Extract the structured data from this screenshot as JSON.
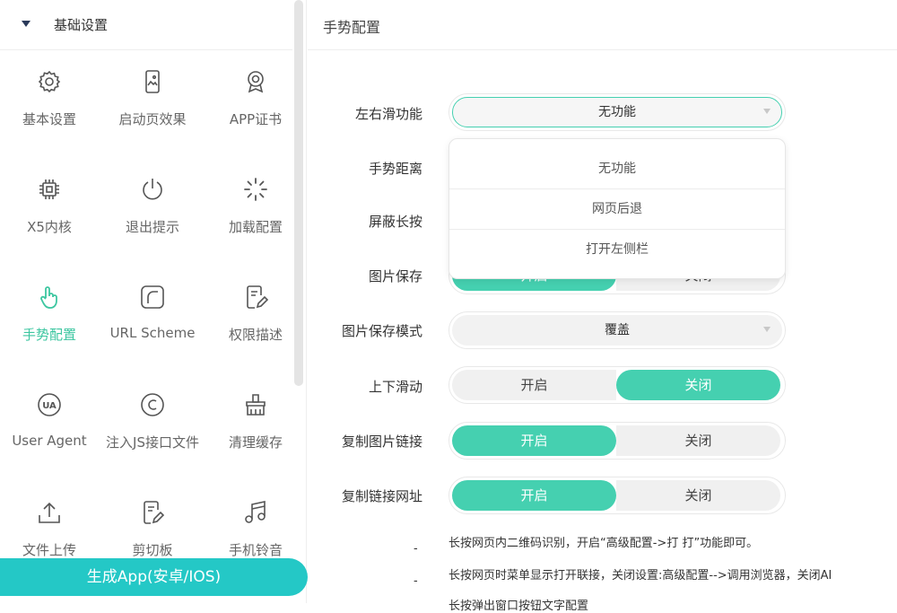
{
  "sidebar": {
    "section_title": "基础设置",
    "items": [
      {
        "label": "基本设置",
        "icon": "gear-icon"
      },
      {
        "label": "启动页效果",
        "icon": "phone-image-icon"
      },
      {
        "label": "APP证书",
        "icon": "certificate-icon"
      },
      {
        "label": "X5内核",
        "icon": "chip-icon"
      },
      {
        "label": "退出提示",
        "icon": "power-icon"
      },
      {
        "label": "加载配置",
        "icon": "loading-spinner-icon"
      },
      {
        "label": "手势配置",
        "icon": "hand-pointer-icon",
        "active": true
      },
      {
        "label": "URL Scheme",
        "icon": "url-scheme-icon"
      },
      {
        "label": "权限描述",
        "icon": "edit-document-icon"
      },
      {
        "label": "User Agent",
        "icon": "ua-icon"
      },
      {
        "label": "注入JS接口文件",
        "icon": "copyright-icon"
      },
      {
        "label": "清理缓存",
        "icon": "broom-icon"
      },
      {
        "label": "文件上传",
        "icon": "upload-icon"
      },
      {
        "label": "剪切板",
        "icon": "clipboard-edit-icon"
      },
      {
        "label": "手机铃音",
        "icon": "music-note-icon"
      }
    ],
    "generate_button": "生成App(安卓/IOS)"
  },
  "main": {
    "title": "手势配置",
    "rows": {
      "swipe_lr": {
        "label": "左右滑功能",
        "value": "无功能"
      },
      "gesture_distance": {
        "label": "手势距离"
      },
      "block_longpress": {
        "label": "屏蔽长按"
      },
      "save_image": {
        "label": "图片保存",
        "on": "开启",
        "off": "关闭"
      },
      "save_mode": {
        "label": "图片保存模式",
        "value": "覆盖"
      },
      "vertical_scroll": {
        "label": "上下滑动",
        "on": "开启",
        "off": "关闭",
        "selected": "off"
      },
      "copy_image_link": {
        "label": "复制图片链接",
        "on": "开启",
        "off": "关闭",
        "selected": "on"
      },
      "copy_link_url": {
        "label": "复制链接网址",
        "on": "开启",
        "off": "关闭",
        "selected": "on"
      }
    },
    "dropdown_options": [
      "无功能",
      "网页后退",
      "打开左侧栏"
    ],
    "notes": [
      "长按网页内二维码识别，开启“高级配置->打 打”功能即可。",
      "长按网页时菜单显示打开联接，关闭设置:高级配置-->调用浏览器，关闭AI",
      "长按弹出窗口按钮文字配置"
    ],
    "note_dash": "-"
  },
  "colors": {
    "accent": "#45d0b0",
    "generate_button": "#24c8c6"
  }
}
